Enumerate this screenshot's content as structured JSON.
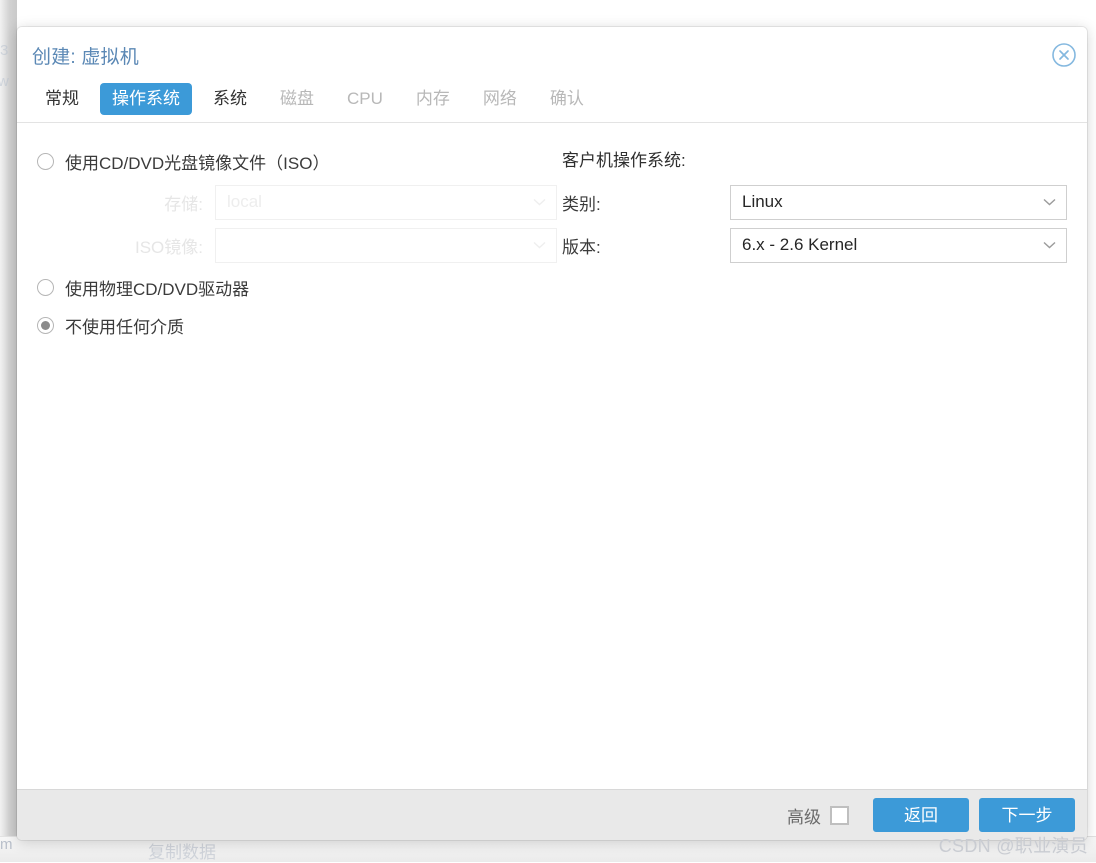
{
  "background": {
    "ghost_char_1": "3",
    "ghost_char_2": "w",
    "ghost_char_3": "m",
    "ghost_copy_text": "复制数据"
  },
  "dialog": {
    "title": "创建: 虚拟机",
    "close_icon": "close-circle-icon",
    "tabs": [
      {
        "label": "常规",
        "state": "enabled"
      },
      {
        "label": "操作系统",
        "state": "active"
      },
      {
        "label": "系统",
        "state": "enabled"
      },
      {
        "label": "磁盘",
        "state": "disabled"
      },
      {
        "label": "CPU",
        "state": "disabled"
      },
      {
        "label": "内存",
        "state": "disabled"
      },
      {
        "label": "网络",
        "state": "disabled"
      },
      {
        "label": "确认",
        "state": "disabled"
      }
    ],
    "media": {
      "options": [
        {
          "label": "使用CD/DVD光盘镜像文件（ISO）",
          "selected": false
        },
        {
          "label": "使用物理CD/DVD驱动器",
          "selected": false
        },
        {
          "label": "不使用任何介质",
          "selected": true
        }
      ],
      "storage_label": "存储:",
      "storage_value": "local",
      "iso_label": "ISO镜像:",
      "iso_value": ""
    },
    "guest_os": {
      "heading": "客户机操作系统:",
      "type_label": "类别:",
      "type_value": "Linux",
      "version_label": "版本:",
      "version_value": "6.x - 2.6 Kernel"
    },
    "footer": {
      "advanced_label": "高级",
      "advanced_checked": false,
      "back_label": "返回",
      "next_label": "下一步"
    }
  },
  "watermark": "CSDN @职业演员",
  "colors": {
    "accent": "#3c9ad8",
    "title": "#5b88b5",
    "footer_bg": "#e9e9e9",
    "disabled_text": "#b8b8b8"
  }
}
